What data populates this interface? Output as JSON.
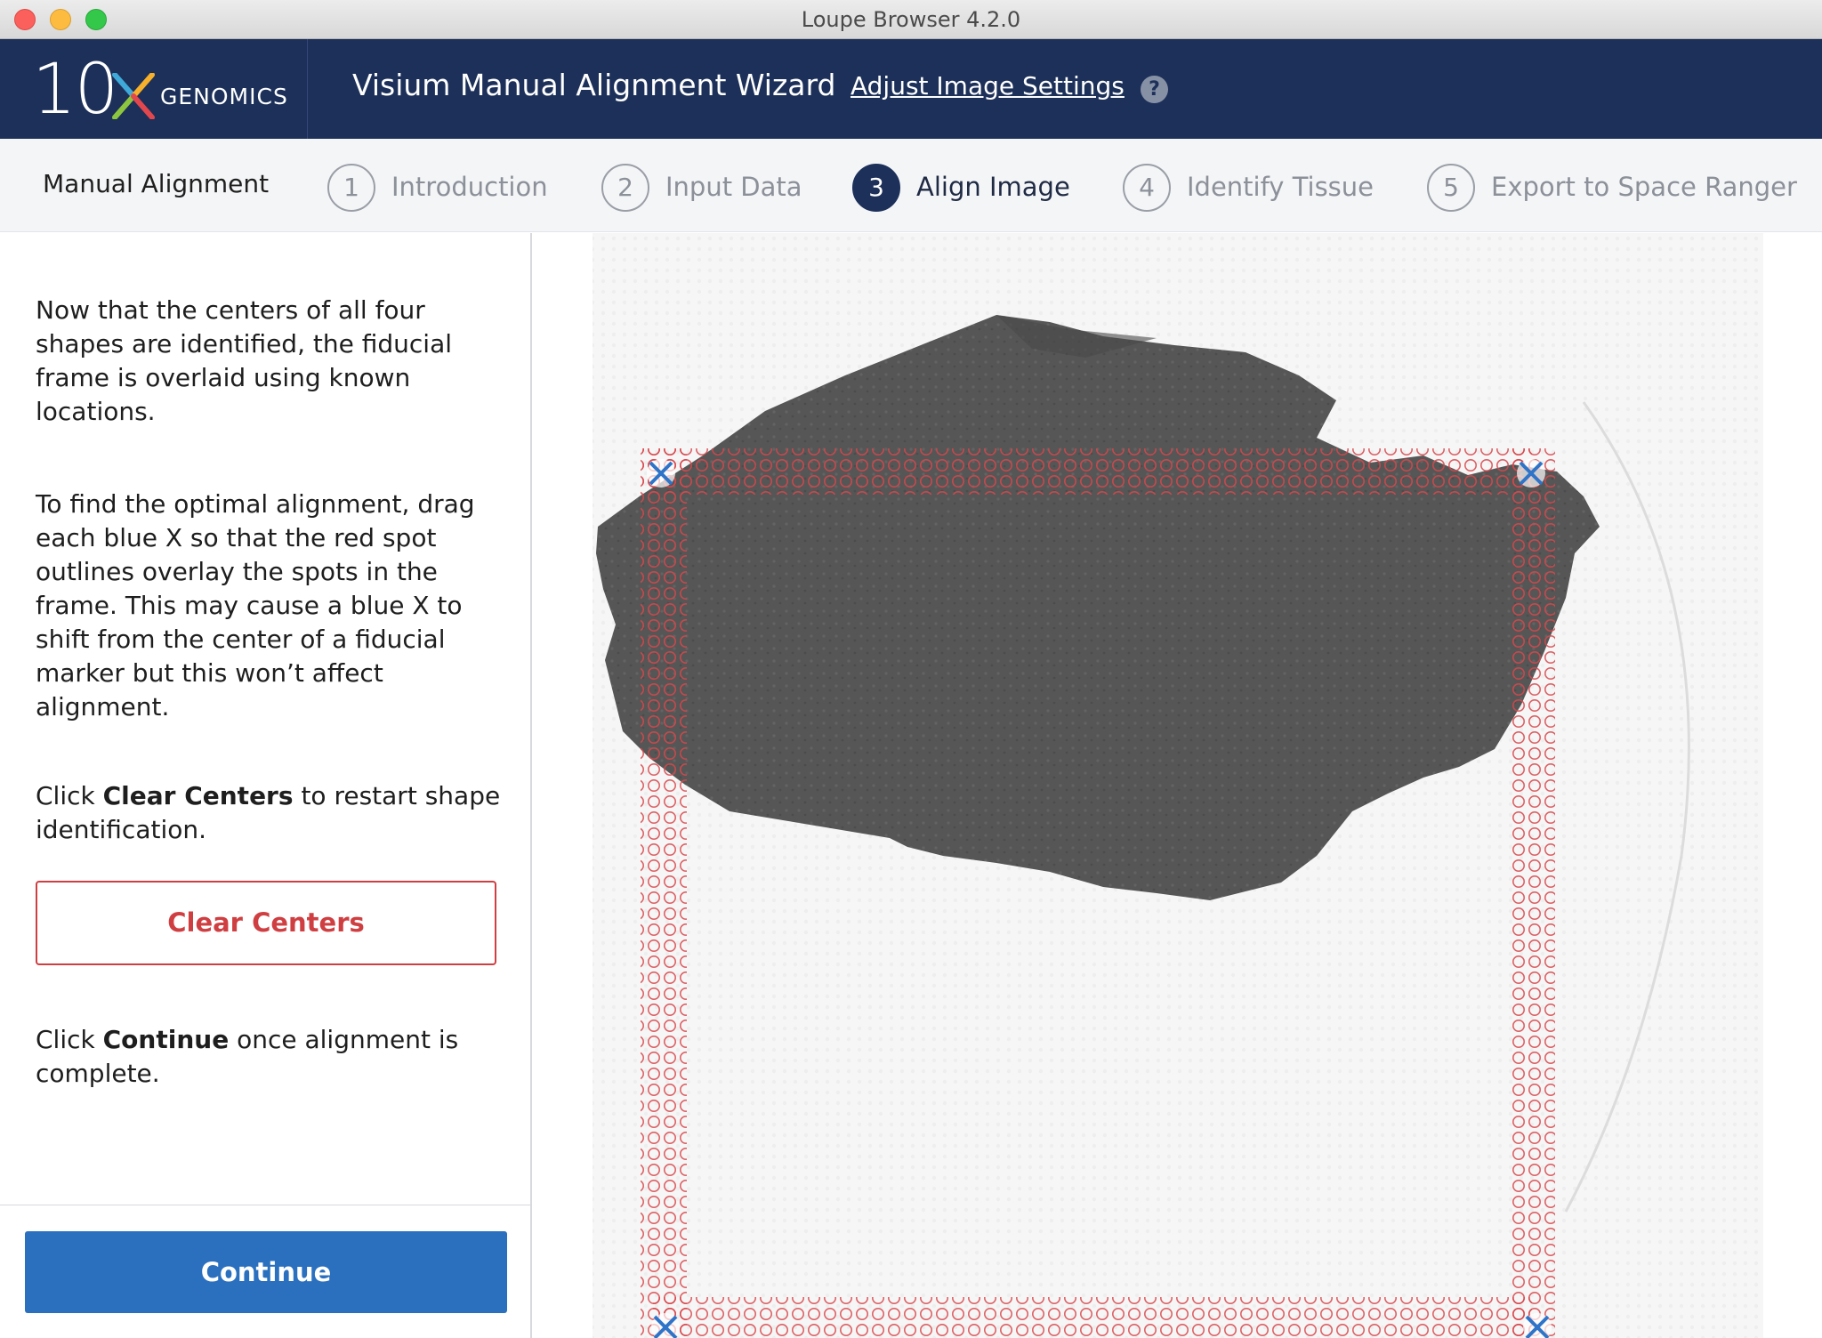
{
  "window": {
    "title": "Loupe Browser 4.2.0"
  },
  "header": {
    "logo_number": "10",
    "logo_text": "GENOMICS",
    "wizard_title": "Visium Manual Alignment Wizard",
    "adjust_link": "Adjust Image Settings",
    "help_glyph": "?"
  },
  "steps": {
    "label": "Manual Alignment",
    "items": [
      {
        "num": "1",
        "label": "Introduction",
        "active": false
      },
      {
        "num": "2",
        "label": "Input Data",
        "active": false
      },
      {
        "num": "3",
        "label": "Align Image",
        "active": true
      },
      {
        "num": "4",
        "label": "Identify Tissue",
        "active": false
      },
      {
        "num": "5",
        "label": "Export to Space Ranger",
        "active": false
      }
    ]
  },
  "panel": {
    "para1": "Now that the centers of all four shapes are identified, the fiducial frame is overlaid using known locations.",
    "para2": "To find the optimal alignment, drag each blue X so that the red spot outlines overlay the spots in the frame. This may cause a blue X to shift from the center of a fiducial marker but this won’t affect alignment.",
    "para3_prefix": "Click ",
    "para3_bold": "Clear Centers",
    "para3_suffix": " to restart shape identification.",
    "clear_button": "Clear Centers",
    "para4_prefix": "Click ",
    "para4_bold": "Continue",
    "para4_suffix": " once alignment is complete.",
    "continue_button": "Continue"
  },
  "icons": {
    "help": "question-circle-icon",
    "handle": "blue-x-handle-icon",
    "logo_x": "logo-x-icon"
  },
  "colors": {
    "header_bg": "#1c3059",
    "accent_blue": "#2a70bf",
    "clear_red": "#cf3f42",
    "spot_outline": "#d9464b",
    "handle_blue": "#2f74c8"
  }
}
